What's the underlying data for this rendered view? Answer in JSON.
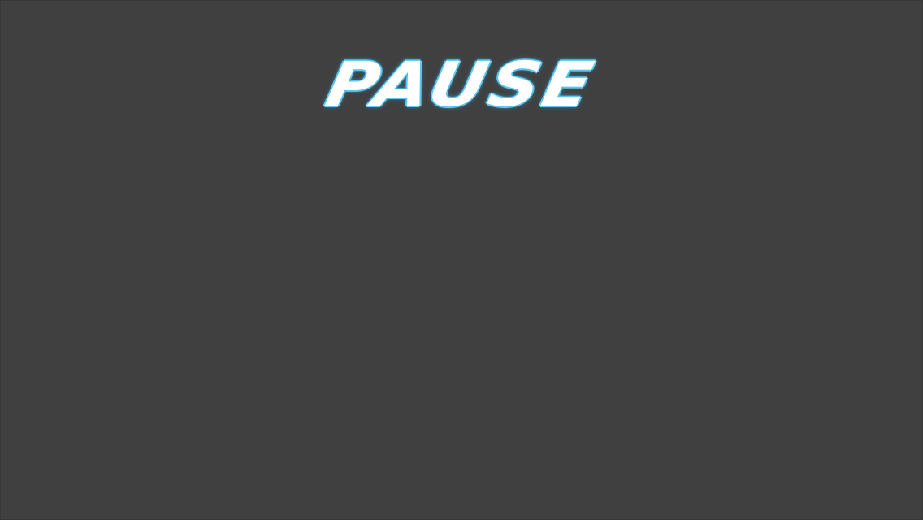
{
  "screen": {
    "title": "PAUSE",
    "background_color": "#404040",
    "title_color": "#ffffff",
    "title_glow_color": "#3ab6e8"
  }
}
